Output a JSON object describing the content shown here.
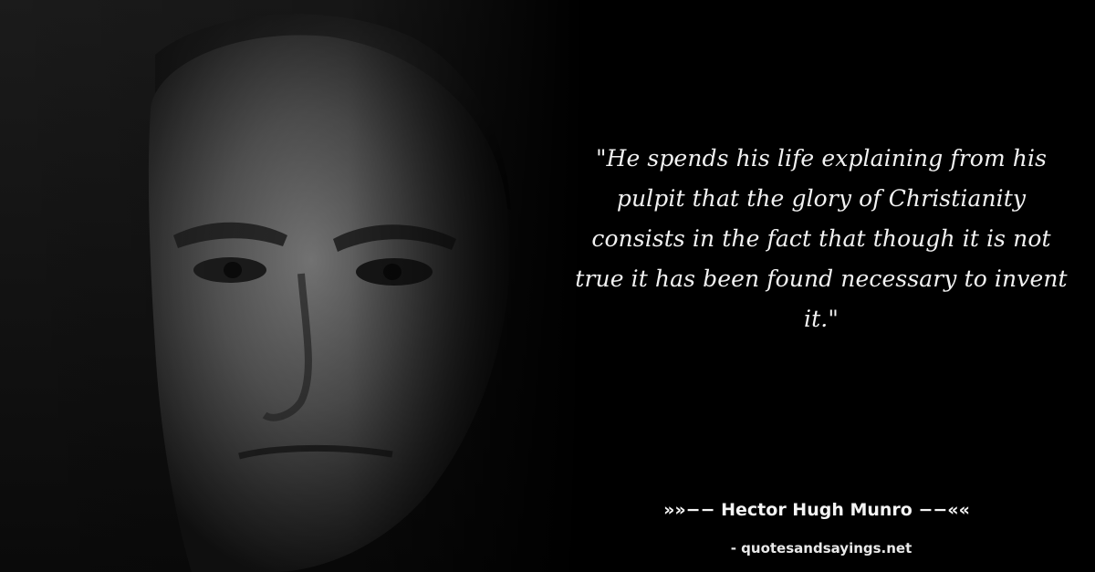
{
  "quote": {
    "text": "\"He spends his life explaining from his pulpit that the glory of Christianity consists in the fact that though it is not true it has been found necessary to invent it.\""
  },
  "author": {
    "line": "»»−− Hector Hugh Munro −−««"
  },
  "source": {
    "line": "- quotesandsayings.net"
  },
  "colors": {
    "background": "#000000",
    "text": "#f2f2f2"
  }
}
